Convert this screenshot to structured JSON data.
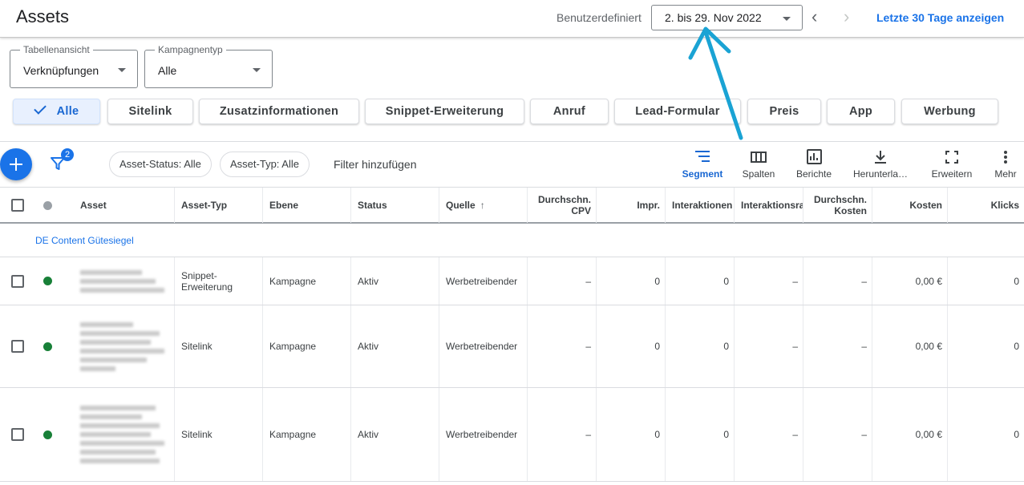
{
  "header": {
    "title": "Assets",
    "date_label": "Benutzerdefiniert",
    "date_range": "2. bis 29. Nov 2022",
    "prev_icon": "chevron-left-icon",
    "next_icon": "chevron-right-icon",
    "last30_label": "Letzte 30 Tage anzeigen"
  },
  "filters": {
    "table_view": {
      "legend": "Tabellenansicht",
      "value": "Verknüpfungen"
    },
    "campaign_type": {
      "legend": "Kampagnentyp",
      "value": "Alle"
    }
  },
  "chips": [
    "Alle",
    "Sitelink",
    "Zusatzinformationen",
    "Snippet-Erweiterung",
    "Anruf",
    "Lead-Formular",
    "Preis",
    "App",
    "Werbung"
  ],
  "active_chip": "Alle",
  "toolbar": {
    "filter_badge": "2",
    "pill_status": "Asset-Status: Alle",
    "pill_type": "Asset-Typ: Alle",
    "add_filter": "Filter hinzufügen",
    "tools": [
      "Segment",
      "Spalten",
      "Berichte",
      "Herunterla…",
      "Erweitern",
      "Mehr"
    ]
  },
  "table": {
    "headers": {
      "asset": "Asset",
      "asset_type": "Asset-Typ",
      "level": "Ebene",
      "status": "Status",
      "source": "Quelle",
      "cpv": "Durchschn. CPV",
      "impr": "Impr.",
      "interactions": "Interaktionen",
      "interaction_rate": "Interaktionsrate",
      "avg_cost": "Durchschn. Kosten",
      "cost": "Kosten",
      "clicks": "Klicks"
    },
    "group_label": "DE Content Gütesiegel",
    "rows": [
      {
        "asset_type": "Snippet-Erweiterung",
        "level": "Kampagne",
        "status": "Aktiv",
        "source": "Werbetreibender",
        "cpv": "–",
        "impr": "0",
        "interactions": "0",
        "interaction_rate": "–",
        "avg_cost": "–",
        "cost": "0,00 €",
        "clicks": "0"
      },
      {
        "asset_type": "Sitelink",
        "level": "Kampagne",
        "status": "Aktiv",
        "source": "Werbetreibender",
        "cpv": "–",
        "impr": "0",
        "interactions": "0",
        "interaction_rate": "–",
        "avg_cost": "–",
        "cost": "0,00 €",
        "clicks": "0"
      },
      {
        "asset_type": "Sitelink",
        "level": "Kampagne",
        "status": "Aktiv",
        "source": "Werbetreibender",
        "cpv": "–",
        "impr": "0",
        "interactions": "0",
        "interaction_rate": "–",
        "avg_cost": "–",
        "cost": "0,00 €",
        "clicks": "0"
      }
    ]
  },
  "colors": {
    "accent": "#1a73e8",
    "active_status": "#188038",
    "annotation_arrow": "#1aa3d4"
  }
}
